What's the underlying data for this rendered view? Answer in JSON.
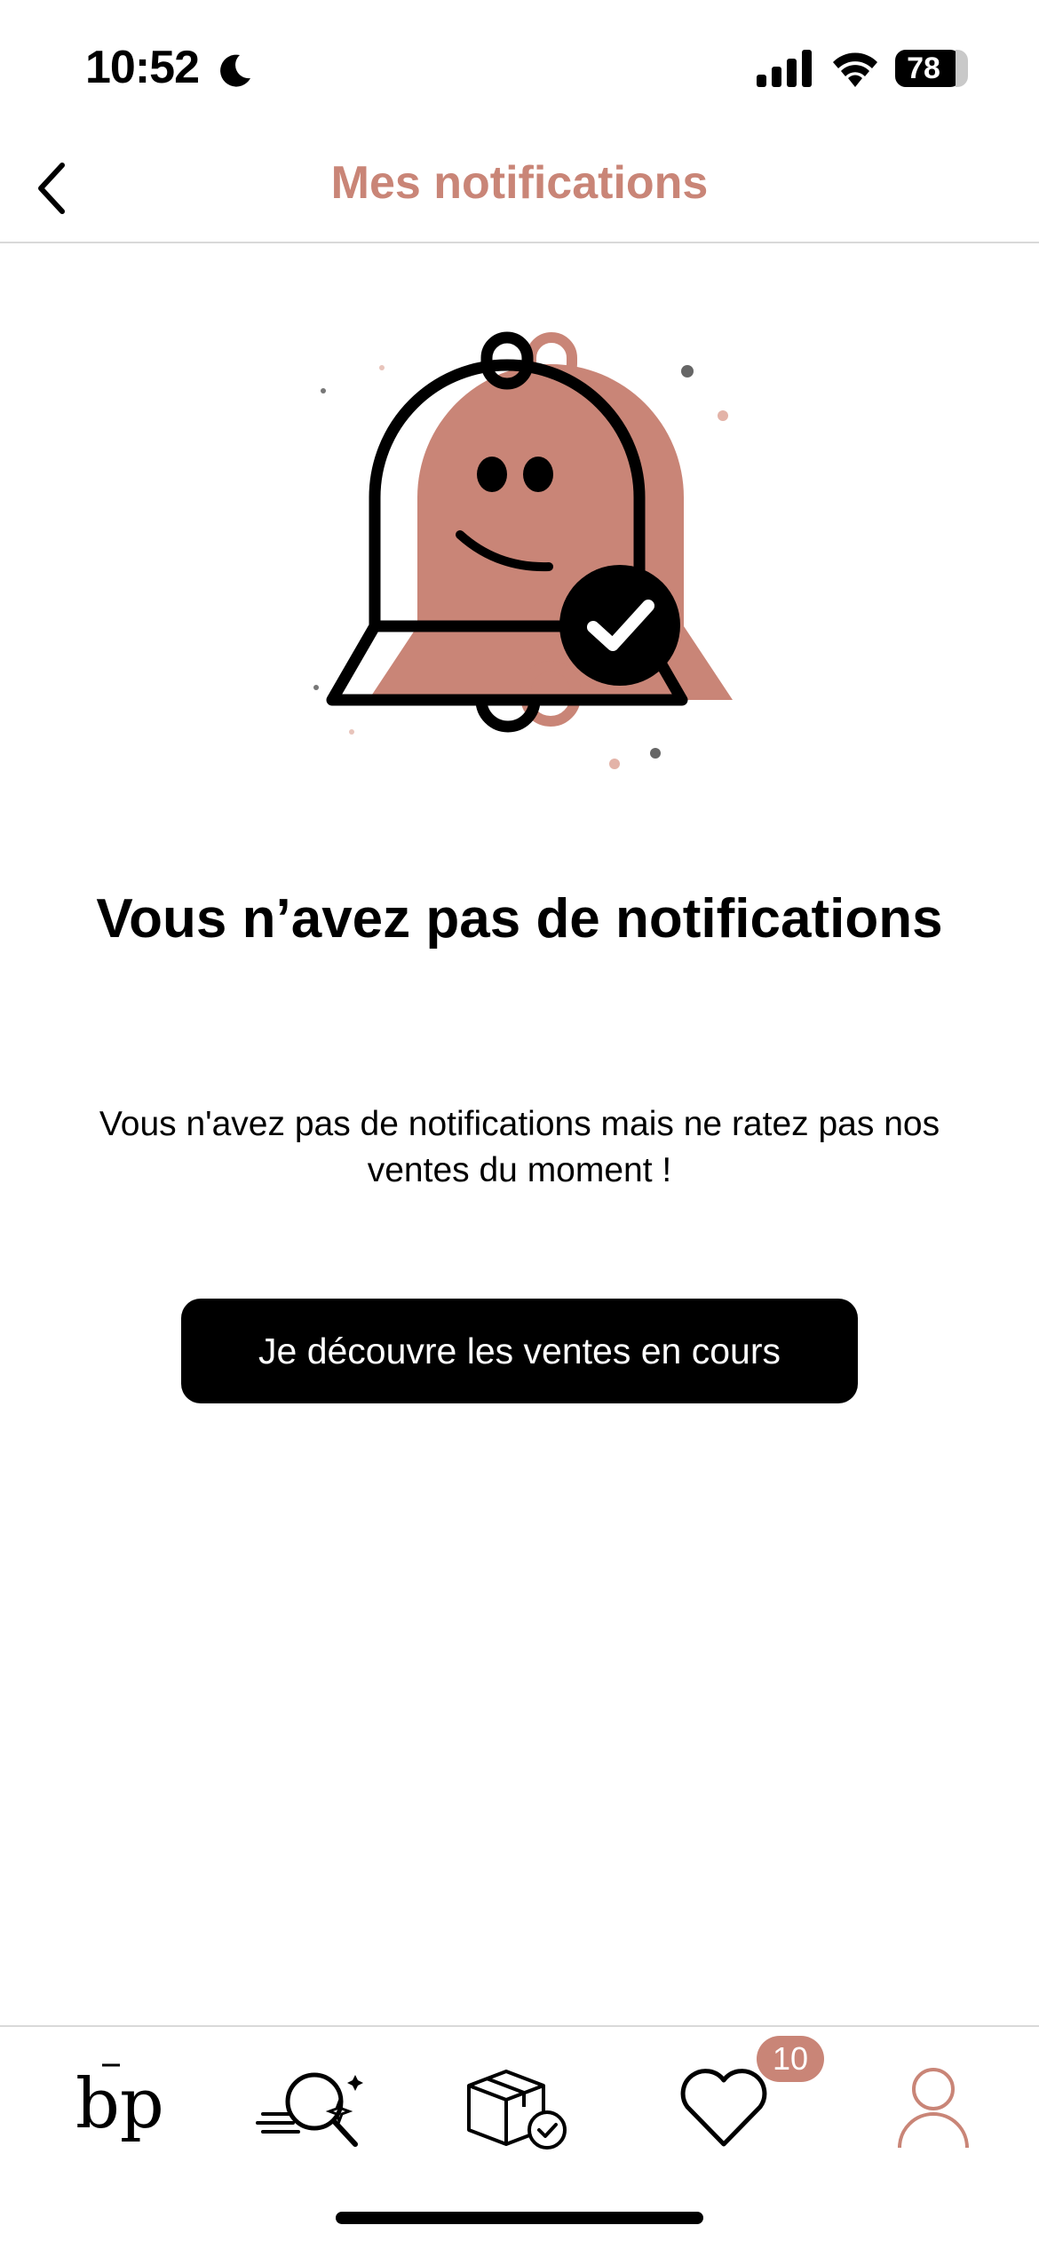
{
  "status_bar": {
    "time": "10:52",
    "battery": "78",
    "icons": [
      "moon-icon",
      "signal-icon",
      "wifi-icon",
      "battery-icon"
    ]
  },
  "header": {
    "title": "Mes notifications",
    "back_icon": "chevron-left-icon"
  },
  "empty_state": {
    "illustration": "smiling-bell-with-check-icon",
    "title": "Vous n’avez pas de notifications",
    "description": "Vous n'avez pas de notifications mais ne ratez pas nos ventes du moment !",
    "cta_label": "Je découvre les ventes en cours"
  },
  "tab_bar": {
    "items": [
      {
        "icon": "bp-logo-icon",
        "logo_text": "bp"
      },
      {
        "icon": "search-sparkle-icon"
      },
      {
        "icon": "package-check-icon"
      },
      {
        "icon": "heart-icon",
        "badge": "10"
      },
      {
        "icon": "user-icon",
        "active": true
      }
    ]
  },
  "colors": {
    "accent": "#c98577",
    "text": "#000000",
    "divider": "#d9d9d9",
    "background": "#ffffff"
  }
}
